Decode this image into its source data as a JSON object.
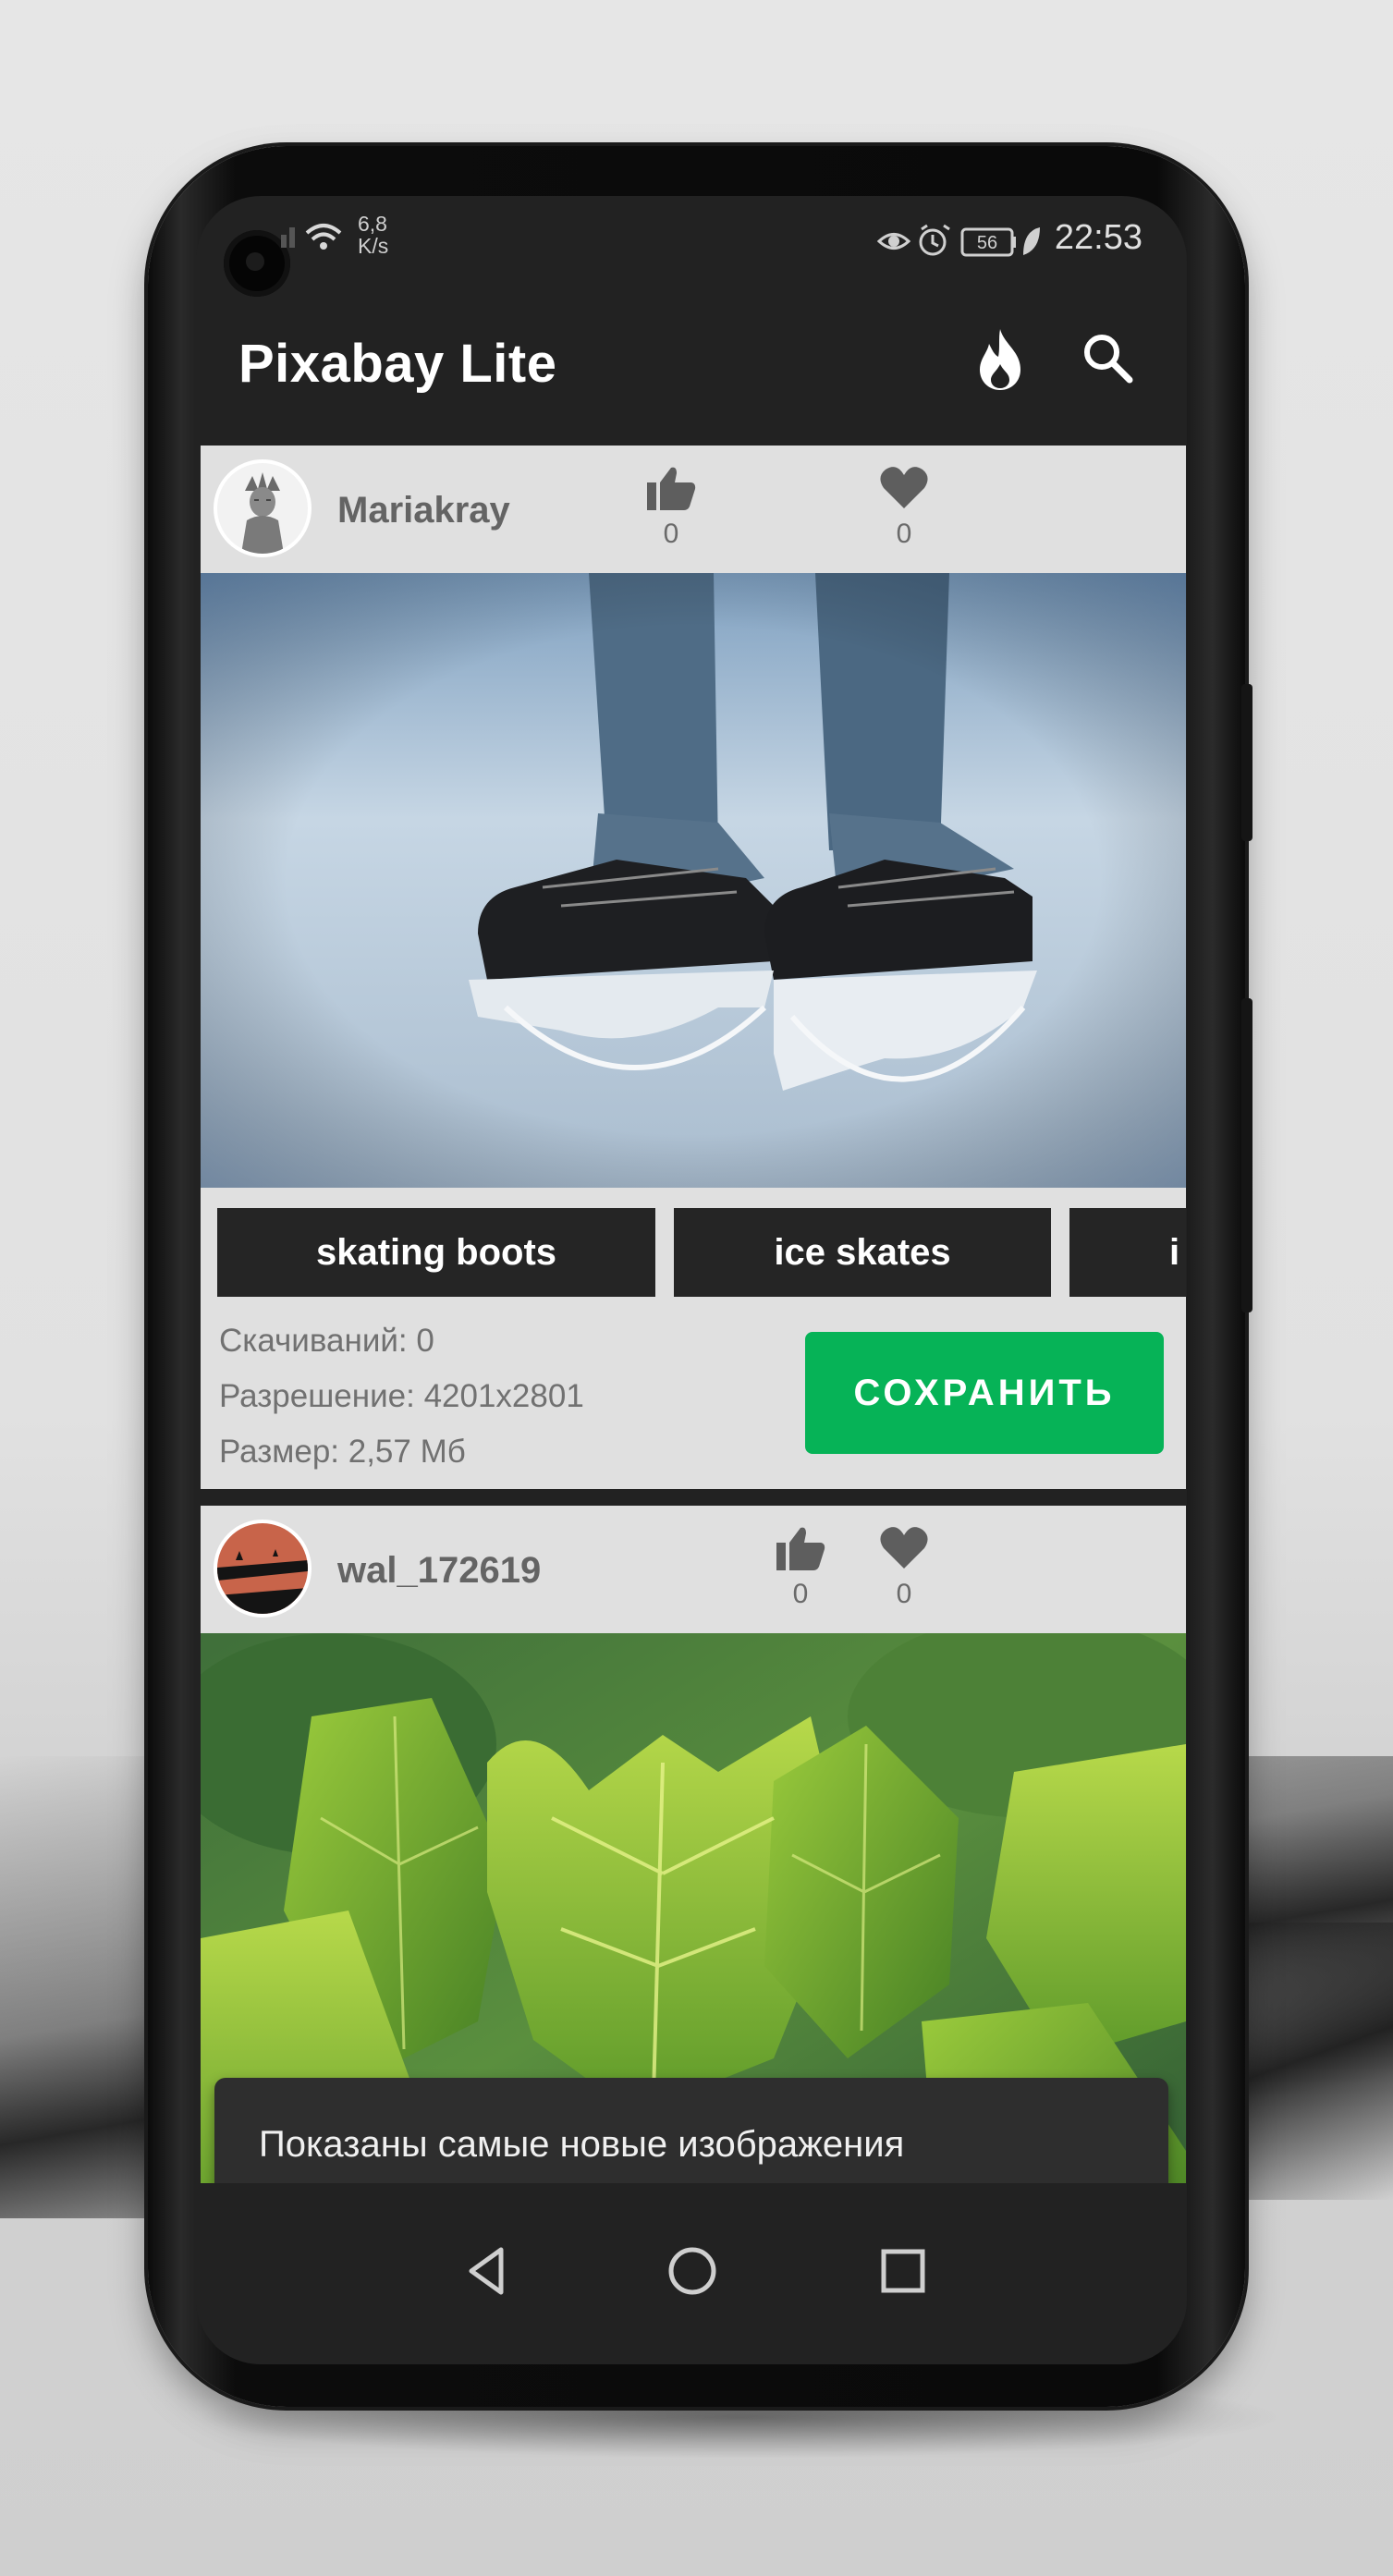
{
  "status_bar": {
    "net_speed_value": "6,8",
    "net_speed_unit": "K/s",
    "battery": "56",
    "time": "22:53"
  },
  "app_bar": {
    "title": "Pixabay Lite"
  },
  "posts": [
    {
      "user": "Mariakray",
      "likes": "0",
      "favorites": "0",
      "tags": [
        "skating boots",
        "ice skates",
        "i"
      ],
      "downloads": "Скачиваний: 0",
      "resolution": "Разрешение: 4201x2801",
      "size": "Размер: 2,57 Мб",
      "save_label": "СОХРАНИТЬ"
    },
    {
      "user": "wal_172619",
      "likes": "0",
      "favorites": "0"
    }
  ],
  "snackbar": {
    "message": "Показаны самые новые изображения"
  },
  "colors": {
    "accent_green": "#06b357",
    "app_bar": "#222222",
    "card_bg": "#e0e0e0"
  },
  "icons": [
    "wifi-icon",
    "eye-icon",
    "alarm-icon",
    "battery-icon",
    "leaf-icon",
    "fire-icon",
    "search-icon",
    "thumb-up-icon",
    "heart-icon",
    "back-icon",
    "home-icon",
    "recents-icon"
  ]
}
